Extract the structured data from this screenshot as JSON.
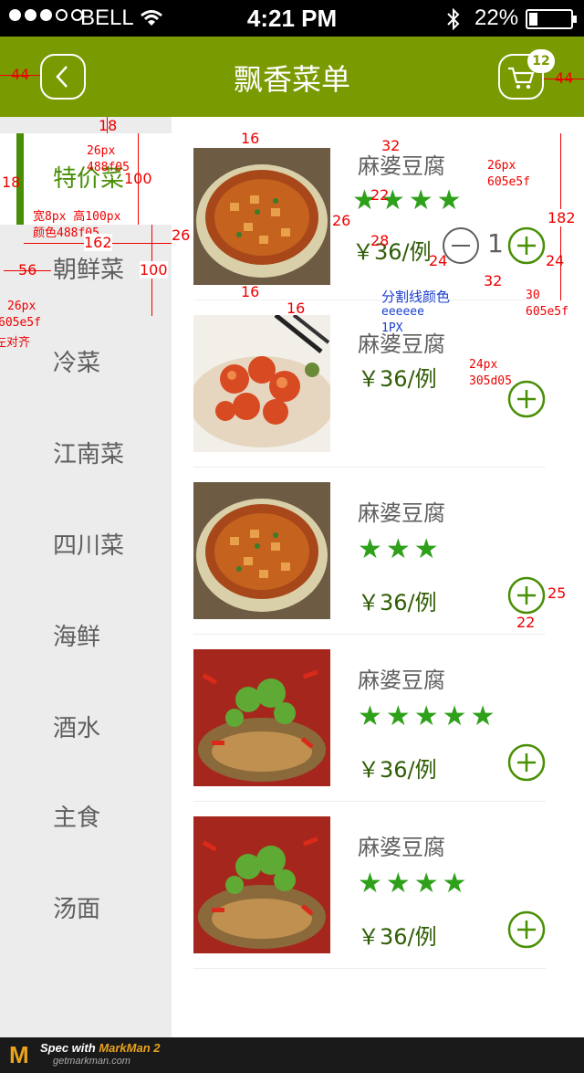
{
  "status_bar": {
    "carrier": "BELL",
    "time": "4:21 PM",
    "battery": "22%",
    "signal_filled": 3,
    "signal_total": 5
  },
  "header": {
    "title": "飘香菜单",
    "cart_count": "12"
  },
  "categories": [
    "特价菜",
    "朝鲜菜",
    "冷菜",
    "江南菜",
    "四川菜",
    "海鲜",
    "酒水",
    "主食",
    "汤面"
  ],
  "items": [
    {
      "name": "麻婆豆腐",
      "stars": "★★★★",
      "price": "￥36/例",
      "quantity": "1",
      "image": "mapo-tofu"
    },
    {
      "name": "麻婆豆腐",
      "stars": "",
      "price": "￥36/例",
      "quantity": "",
      "image": "sweet-sour-pork"
    },
    {
      "name": "麻婆豆腐",
      "stars": "★★★",
      "price": "￥36/例",
      "quantity": "",
      "image": "mapo-tofu"
    },
    {
      "name": "麻婆豆腐",
      "stars": "★★★★★",
      "price": "￥36/例",
      "quantity": "",
      "image": "spicy-fish"
    },
    {
      "name": "麻婆豆腐",
      "stars": "★★★★",
      "price": "￥36/例",
      "quantity": "",
      "image": "spicy-fish"
    }
  ],
  "annotations": {
    "a44l": "44",
    "a44r": "44",
    "a18a": "18",
    "a18b": "18",
    "a16a": "16",
    "a16b": "16",
    "a16c": "16",
    "a32a": "32",
    "a32b": "32",
    "a100a": "100",
    "a100b": "100",
    "a162": "162",
    "a56": "56",
    "a26a": "26",
    "a26b": "26",
    "a22a": "22",
    "a22b": "22",
    "a28": "28",
    "a24a": "24",
    "a24b": "24",
    "a182": "182",
    "a25": "25",
    "note_active_font": "26px",
    "note_active_color": "488f05",
    "note_bar": "宽8px 高100px",
    "note_bar_color": "颜色488f05",
    "note_cat_font": "26px",
    "note_cat_color": "605e5f",
    "note_align": "左对齐",
    "note_name_font": "26px",
    "note_name_color": "605e5f",
    "note_divider": "分割线颜色",
    "note_divider_color": "eeeeee",
    "note_divider_width": "1PX",
    "note_price_font": "24px",
    "note_price_color": "305d05",
    "note_btn_size": "30",
    "note_btn_color": "605e5f"
  },
  "footer": {
    "brand": "Spec with",
    "brand_name": "MarkMan 2",
    "url": "getmarkman.com"
  },
  "colors": {
    "header": "#7a9a01",
    "active": "#488f05",
    "text": "#605e5f",
    "price": "#305d05",
    "star": "#2ea01a",
    "divider": "#eeeeee",
    "annotation": "#e00000"
  }
}
